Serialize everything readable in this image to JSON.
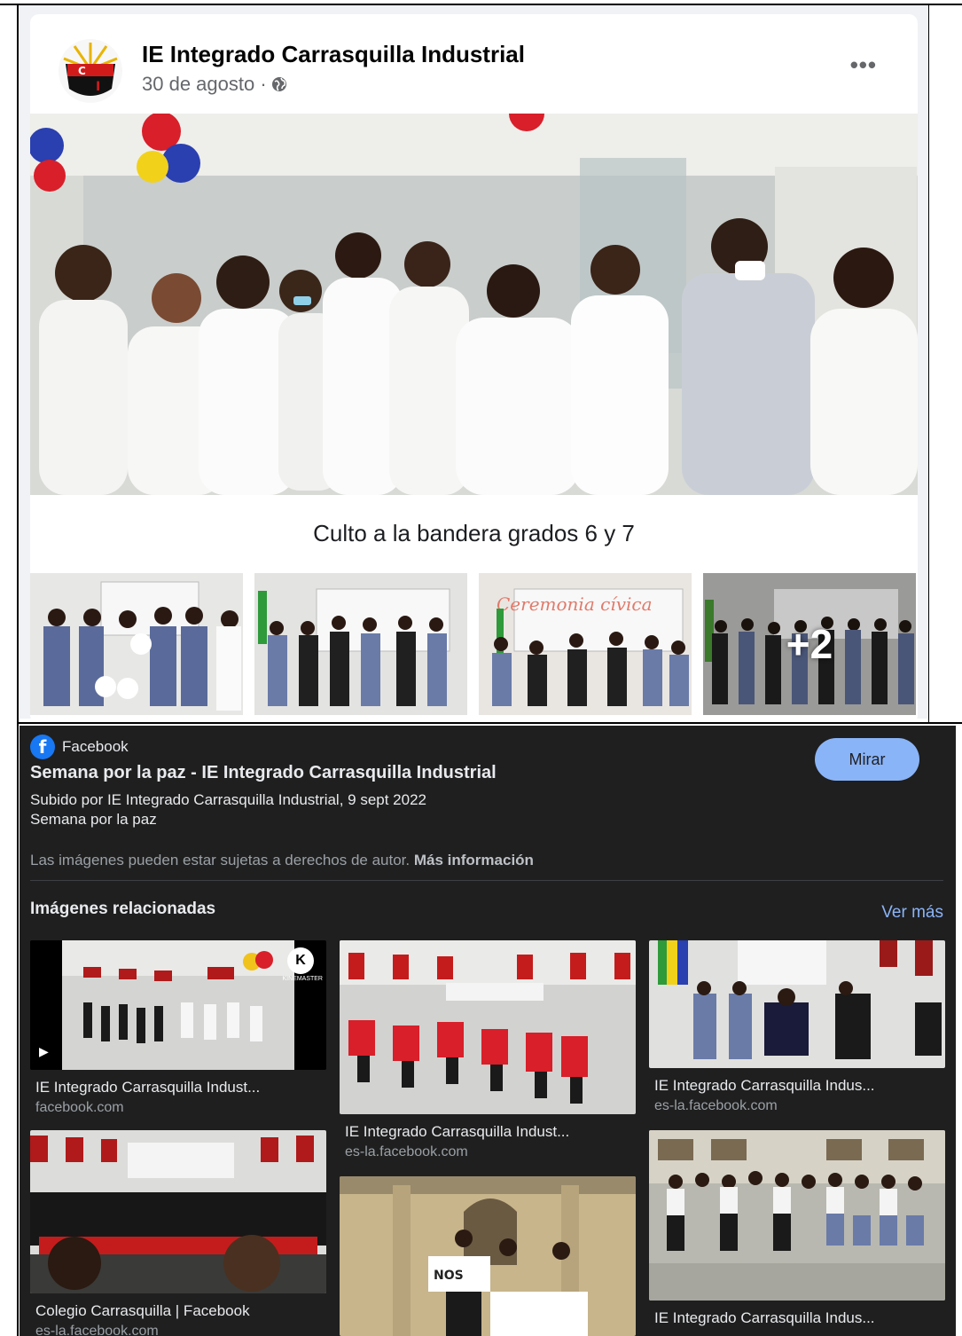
{
  "post": {
    "page_name": "IE Integrado Carrasquilla Industrial",
    "date": "30 de agosto ·",
    "privacy_icon": "globe-icon",
    "more_icon": "more-horizontal-icon",
    "more_label": "•••",
    "caption": "Culto a la bandera grados 6 y 7",
    "extra_photos_label": "+2",
    "logo_letters": "C I"
  },
  "result": {
    "source": "Facebook",
    "source_logo_letter": "f",
    "watch_label": "Mirar",
    "title": "Semana por la paz - IE Integrado Carrasquilla Industrial",
    "uploaded": "Subido por IE Integrado Carrasquilla Industrial, 9 sept 2022",
    "description": "Semana por la paz",
    "copyright_text": "Las imágenes pueden estar sujetas a derechos de autor.",
    "copyright_link": "Más información"
  },
  "related": {
    "heading": "Imágenes relacionadas",
    "see_more": "Ver más",
    "cards": [
      {
        "title": "IE Integrado Carrasquilla Indust...",
        "domain": "facebook.com",
        "badge": "K",
        "badge_text": "KINEMASTER",
        "play": "▶"
      },
      {
        "title": "IE Integrado Carrasquilla Indust...",
        "domain": "es-la.facebook.com"
      },
      {
        "title": "IE Integrado Carrasquilla Indus...",
        "domain": "es-la.facebook.com"
      },
      {
        "title": "Colegio Carrasquilla | Facebook",
        "domain": "es-la.facebook.com"
      },
      {
        "title": "",
        "domain": ""
      },
      {
        "title": "IE Integrado Carrasquilla Indus...",
        "domain": ""
      }
    ]
  },
  "colors": {
    "facebook_blue": "#1877f2",
    "dark_panel": "#1f1f1f",
    "link_blue": "#8ab4f8"
  }
}
